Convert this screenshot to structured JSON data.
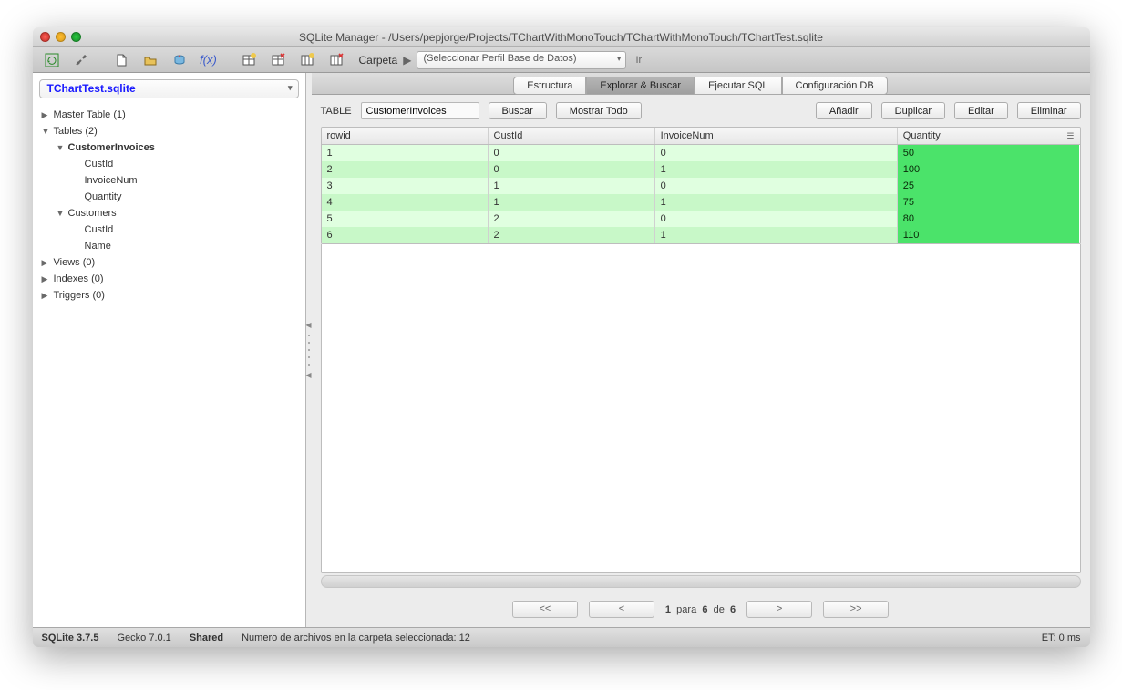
{
  "window_title": "SQLite Manager - /Users/pepjorge/Projects/TChartWithMonoTouch/TChartWithMonoTouch/TChartTest.sqlite",
  "toolbar": {
    "carpeta_label": "Carpeta",
    "db_profile_placeholder": "(Seleccionar Perfil Base de Datos)",
    "ir_label": "Ir"
  },
  "sidebar": {
    "current_db": "TChartTest.sqlite",
    "tree": {
      "master": "Master Table (1)",
      "tables": "Tables (2)",
      "customer_invoices": "CustomerInvoices",
      "ci_cols": [
        "CustId",
        "InvoiceNum",
        "Quantity"
      ],
      "customers": "Customers",
      "c_cols": [
        "CustId",
        "Name"
      ],
      "views": "Views (0)",
      "indexes": "Indexes (0)",
      "triggers": "Triggers (0)"
    }
  },
  "tabs": {
    "estructura": "Estructura",
    "explorar": "Explorar & Buscar",
    "ejecutar": "Ejecutar SQL",
    "config": "Configuración DB"
  },
  "tablebar": {
    "label": "TABLE",
    "table_name": "CustomerInvoices",
    "buscar": "Buscar",
    "mostrar_todo": "Mostrar Todo",
    "anadir": "Añadir",
    "duplicar": "Duplicar",
    "editar": "Editar",
    "eliminar": "Eliminar"
  },
  "grid": {
    "columns": [
      "rowid",
      "CustId",
      "InvoiceNum",
      "Quantity"
    ],
    "rows": [
      {
        "rowid": "1",
        "CustId": "0",
        "InvoiceNum": "0",
        "Quantity": "50"
      },
      {
        "rowid": "2",
        "CustId": "0",
        "InvoiceNum": "1",
        "Quantity": "100"
      },
      {
        "rowid": "3",
        "CustId": "1",
        "InvoiceNum": "0",
        "Quantity": "25"
      },
      {
        "rowid": "4",
        "CustId": "1",
        "InvoiceNum": "1",
        "Quantity": "75"
      },
      {
        "rowid": "5",
        "CustId": "2",
        "InvoiceNum": "0",
        "Quantity": "80"
      },
      {
        "rowid": "6",
        "CustId": "2",
        "InvoiceNum": "1",
        "Quantity": "110"
      }
    ]
  },
  "pager": {
    "first": "<<",
    "prev": "<",
    "page_current": "1",
    "para": "para",
    "page_total": "6",
    "de": "de",
    "rows_total": "6",
    "next": ">",
    "last": ">>"
  },
  "status": {
    "sqlite": "SQLite 3.7.5",
    "gecko": "Gecko 7.0.1",
    "shared": "Shared",
    "message": "Numero de archivos en la carpeta seleccionada: 12",
    "et": "ET: 0 ms"
  }
}
